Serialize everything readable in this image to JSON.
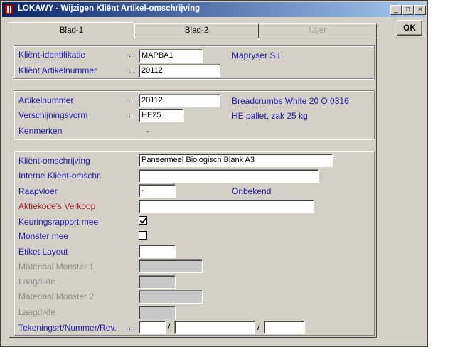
{
  "window": {
    "title": "LOKAWY - Wijzigen Kliënt Artikel-omschrijving",
    "min_glyph": "_",
    "max_glyph": "□",
    "close_glyph": "×"
  },
  "tabs": [
    {
      "label": "Blad-1",
      "state": "active"
    },
    {
      "label": "Blad-2",
      "state": "inactive"
    },
    {
      "label": "User",
      "state": "disabled"
    }
  ],
  "ok_label": "OK",
  "group1": {
    "client_id_label": "Kliënt-identifikatie",
    "client_id_value": "MAPBA1",
    "client_name": "Mapryser S.L.",
    "client_article_label": "Kliënt Artikelnummer",
    "client_article_value": "20112",
    "dots": "..."
  },
  "group2": {
    "article_label": "Artikelnummer",
    "article_value": "20112",
    "article_desc": "Breadcrumbs White 20 O 0316",
    "form_label": "Verschijningsvorm",
    "form_value": "HE25",
    "form_desc": "HE pallet, zak 25 kg",
    "features_label": "Kenmerken",
    "features_value": "-",
    "dots": "..."
  },
  "group3": {
    "client_desc_label": "Kliënt-omschrijving",
    "client_desc_value": "Paneermeel Biologisch Blank A3",
    "internal_desc_label": "Interne Kliënt-omschr.",
    "internal_desc_value": "",
    "floor_label": "Raapvloer",
    "floor_value": "-",
    "floor_desc": "Onbekend",
    "action_codes_label": "Aktiekode's Verkoop",
    "action_codes_value": "",
    "inspection_label": "Keuringsrapport mee",
    "inspection_checked": true,
    "sample_label": "Monster mee",
    "sample_checked": false,
    "etiket_label": "Etiket Layout",
    "etiket_value": "",
    "material1_label": "Materiaal Monster 1",
    "layer1_label": "Laagdikte",
    "material2_label": "Materiaal Monster 2",
    "layer2_label": "Laagdikte",
    "drawing_label": "Tekeningsrt/Nummer/Rev.",
    "drawing_dots": "...",
    "slash": "/"
  }
}
